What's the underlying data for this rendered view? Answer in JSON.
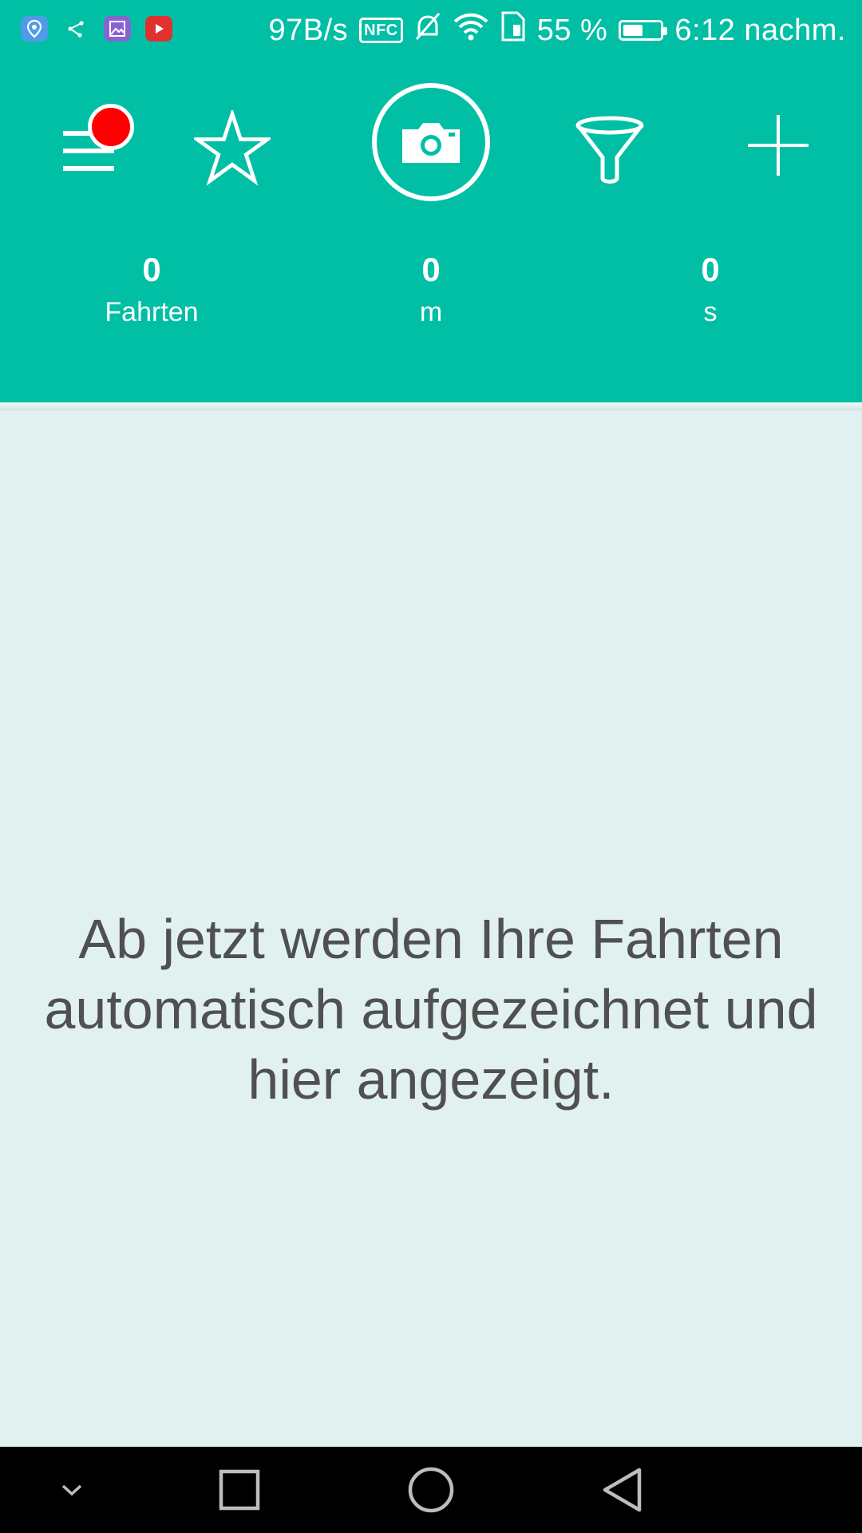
{
  "status_bar": {
    "notification_icons": [
      "location-pin-icon",
      "share-graph-icon",
      "gallery-icon",
      "youtube-icon"
    ],
    "network_speed": "97B/s",
    "nfc_label": "NFC",
    "battery_percent": "55 %",
    "battery_level": 0.55,
    "time": "6:12 nachm.",
    "colors": {
      "location": "#4f9be8",
      "share": "#00bfa5",
      "gallery": "#8a63d2",
      "youtube": "#e03030"
    }
  },
  "toolbar": {
    "icons": [
      "menu-icon",
      "star-icon",
      "camera-icon",
      "filter-icon",
      "plus-icon"
    ],
    "menu_has_notification": true
  },
  "stats": [
    {
      "value": "0",
      "label": "Fahrten"
    },
    {
      "value": "0",
      "label": "m"
    },
    {
      "value": "0",
      "label": "s"
    }
  ],
  "empty_state": {
    "message": "Ab jetzt werden Ihre Fahrten automatisch aufgezeichnet und hier angezeigt."
  },
  "nav_bar": {
    "icons": [
      "collapse-chevron-icon",
      "recents-icon",
      "home-icon",
      "back-icon"
    ]
  },
  "theme": {
    "primary": "#00bfa5",
    "background": "#e1f1f0",
    "text_dark": "#505050",
    "notification_dot": "#ff0000"
  }
}
